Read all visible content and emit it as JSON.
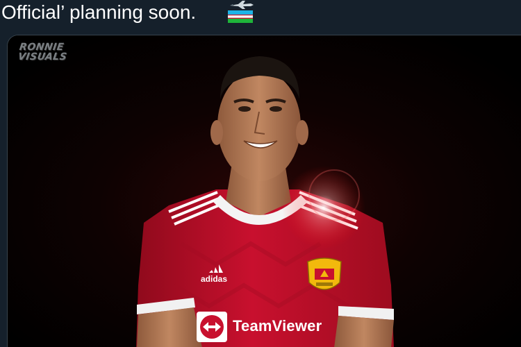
{
  "tweet": {
    "text": "Official’ planning soon.",
    "emoji_plane": "airplane-emoji",
    "emoji_flag": "uzbekistan-flag-emoji"
  },
  "media": {
    "watermark": "RONNIE\nVISUALS",
    "kit_brand": "adidas",
    "sponsor": "TeamViewer",
    "colors": {
      "shirt": "#c8102e",
      "shirt_dark": "#8f0a1c",
      "background": "#000000",
      "skin": "#b27a56",
      "hair": "#1b1410",
      "crest_gold": "#f2b90d"
    }
  }
}
